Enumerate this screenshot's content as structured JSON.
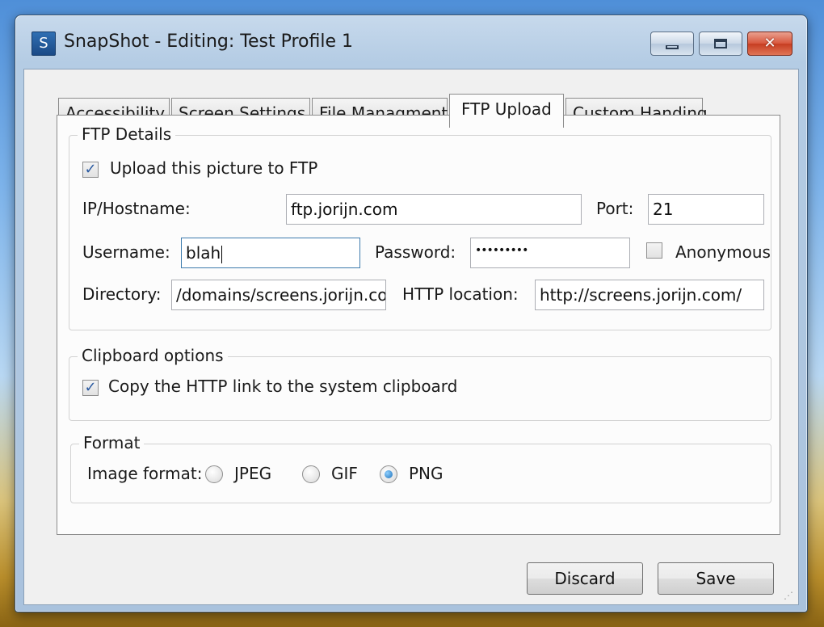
{
  "window": {
    "app_icon_letter": "S",
    "title": "SnapShot - Editing: Test Profile 1"
  },
  "tabs": [
    {
      "label": "Accessibility"
    },
    {
      "label": "Screen Settings"
    },
    {
      "label": "File Managment"
    },
    {
      "label": "FTP Upload"
    },
    {
      "label": "Custom Handing"
    }
  ],
  "active_tab": "FTP Upload",
  "ftp": {
    "legend": "FTP Details",
    "upload_label": "Upload this picture to FTP",
    "upload_checked": true,
    "host_label": "IP/Hostname:",
    "host_value": "ftp.jorijn.com",
    "port_label": "Port:",
    "port_value": "21",
    "username_label": "Username:",
    "username_value": "blah",
    "password_label": "Password:",
    "password_value": "•••••••••",
    "anonymous_label": "Anonymous",
    "anonymous_checked": false,
    "directory_label": "Directory:",
    "directory_value": "/domains/screens.jorijn.com",
    "http_label": "HTTP location:",
    "http_value": "http://screens.jorijn.com/"
  },
  "clipboard": {
    "legend": "Clipboard options",
    "copy_label": "Copy the HTTP link to the system clipboard",
    "copy_checked": true
  },
  "format": {
    "legend": "Format",
    "image_format_label": "Image format:",
    "options": [
      "JPEG",
      "GIF",
      "PNG"
    ],
    "selected": "PNG"
  },
  "buttons": {
    "discard": "Discard",
    "save": "Save"
  },
  "colors": {
    "accent": "#2b5aa0",
    "close_button": "#c63d21"
  }
}
